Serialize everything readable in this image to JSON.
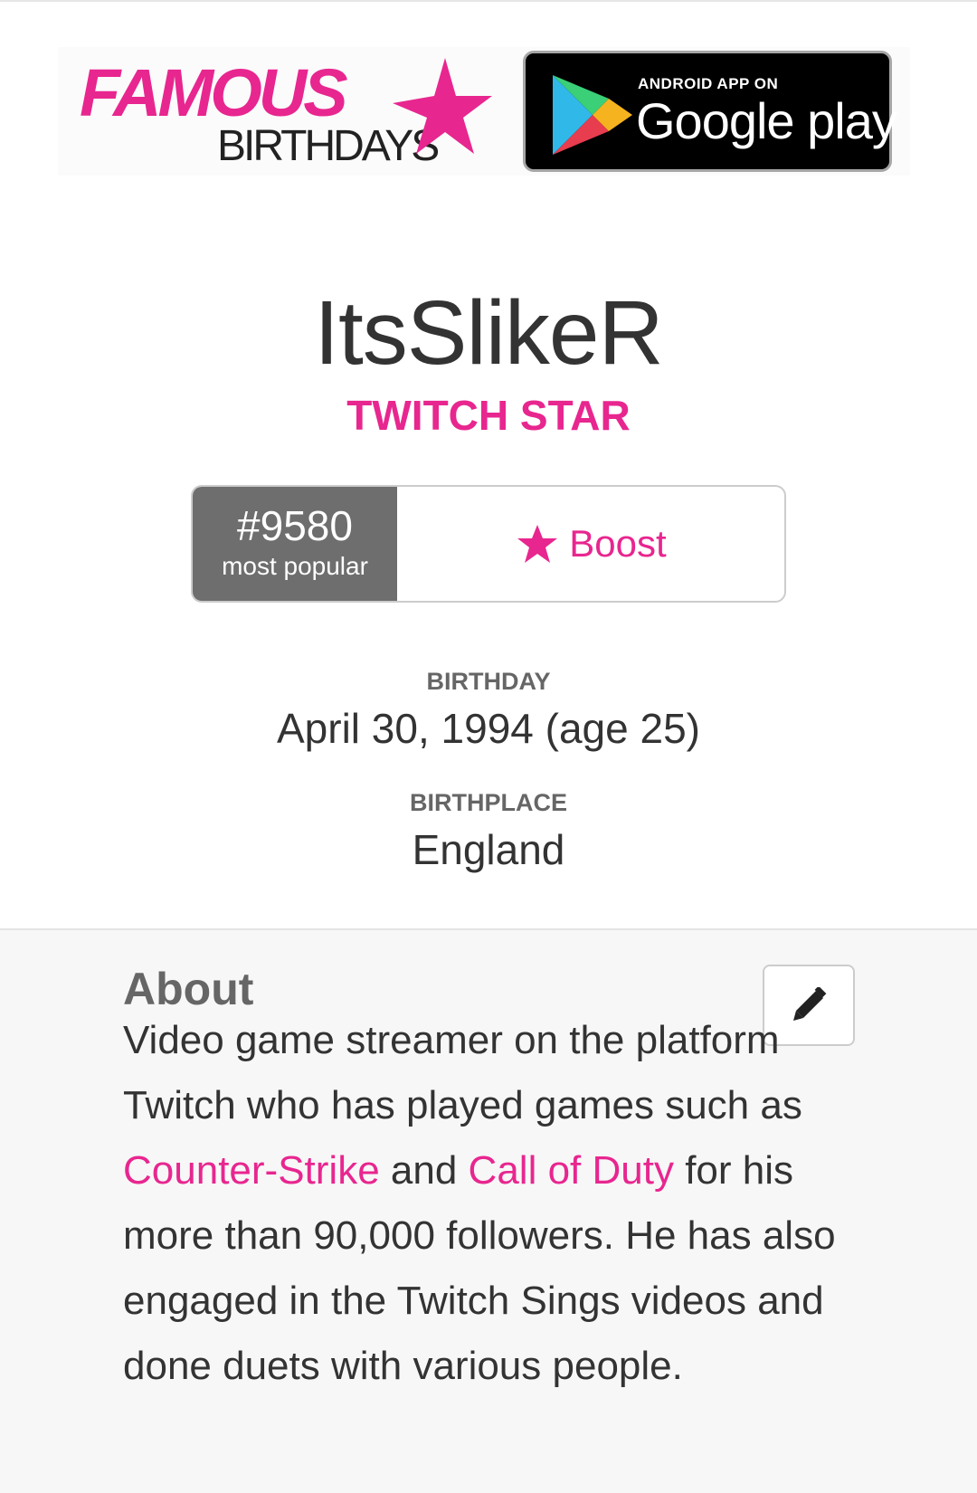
{
  "header": {
    "logo_famous": "FAMOUS",
    "logo_birthdays": "BIRTHDAYS",
    "logo_star_icon": "star-icon",
    "google_play": {
      "small_text": "ANDROID APP ON",
      "big_text": "Google play",
      "icon": "play-triangle-icon"
    }
  },
  "profile": {
    "name": "ItsSlikeR",
    "category": "TWITCH STAR",
    "rank": {
      "number": "#9580",
      "label": "most popular"
    },
    "boost": {
      "label": "Boost",
      "icon": "star-icon"
    },
    "birthday": {
      "label": "BIRTHDAY",
      "value": "April 30, 1994 (age 25)"
    },
    "birthplace": {
      "label": "BIRTHPLACE",
      "value": "England"
    }
  },
  "about": {
    "title": "About",
    "edit_icon": "pencil-icon",
    "text_part1": "Video game streamer on the platform Twitch who has played games such as ",
    "link1": "Counter-Strike",
    "text_part2": " and ",
    "link2": "Call of Duty",
    "text_part3": " for his more than 90,000 followers. He has also engaged in the Twitch Sings videos and done duets with various people."
  },
  "colors": {
    "accent": "#e8268f",
    "rank_bg": "#6e6e6e",
    "about_bg": "#f7f7f7"
  }
}
